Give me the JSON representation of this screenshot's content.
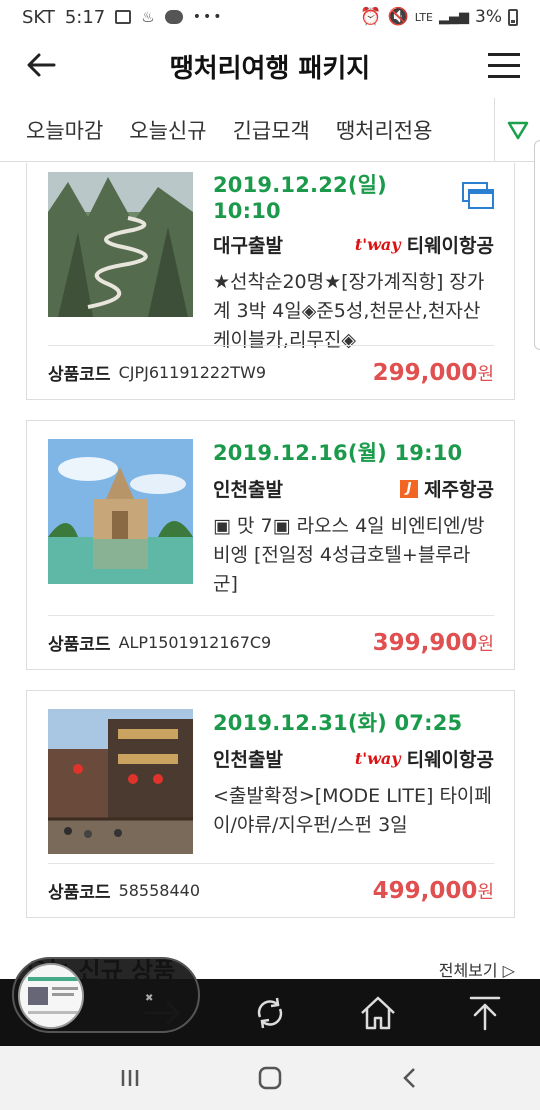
{
  "status": {
    "carrier": "SKT",
    "time": "5:17",
    "net": "LTE",
    "battery": "3%"
  },
  "header": {
    "title": "땡처리여행 패키지"
  },
  "tabs": [
    "오늘마감",
    "오늘신규",
    "긴급모객",
    "땡처리전용"
  ],
  "products": [
    {
      "date": "2019.12.22(일) 10:10",
      "departure": "대구출발",
      "airline_logo": "t'way",
      "airline": "티웨이항공",
      "description": "★선착순20명★[장가계직항] 장가계 3박 4일◈준5성,천문산,천자산케이블카,리무진◈",
      "code_label": "상품코드",
      "code": "CJPJ61191222TW9",
      "price": "299,000",
      "currency": "원"
    },
    {
      "date": "2019.12.16(월) 19:10",
      "departure": "인천출발",
      "airline_logo": "J",
      "airline": "제주항공",
      "description": "▣ 맛 7▣ 라오스 4일 비엔티엔/방비엥 [전일정 4성급호텔+블루라군]",
      "code_label": "상품코드",
      "code": "ALP1501912167C9",
      "price": "399,900",
      "currency": "원"
    },
    {
      "date": "2019.12.31(화) 07:25",
      "departure": "인천출발",
      "airline_logo": "t'way",
      "airline": "티웨이항공",
      "description": "<출발확정>[MODE LITE] 타이페이/야류/지우펀/스펀 3일",
      "code_label": "상품코드",
      "code": "58558440",
      "price": "499,000",
      "currency": "원"
    }
  ],
  "section": {
    "title": "오늘 신규 상품",
    "more": "전체보기 ▷"
  },
  "colors": {
    "date_green": "#1a9a4a",
    "price_red": "#e05050",
    "accent_green": "#1aa14b",
    "tway_red": "#dd1111",
    "jeju_orange": "#f26522"
  }
}
